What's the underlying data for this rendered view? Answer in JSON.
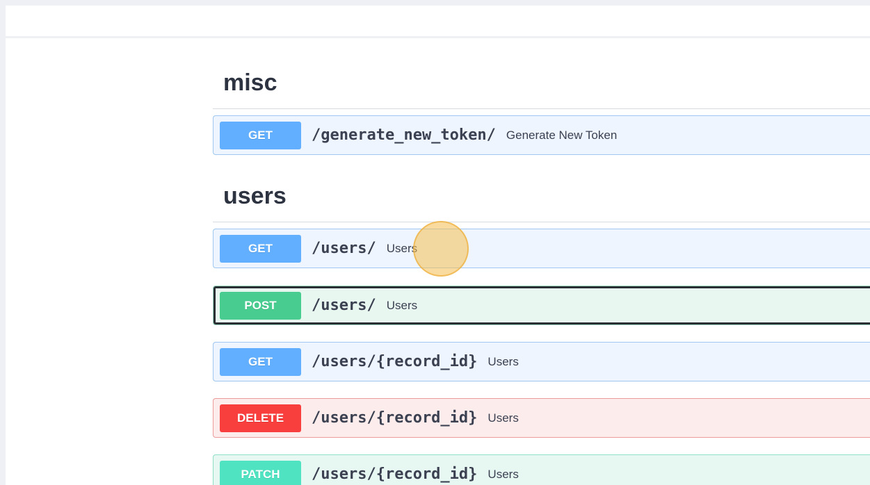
{
  "sections": [
    {
      "title": "misc",
      "operations": [
        {
          "method": "GET",
          "path": "/generate_new_token/",
          "summary": "Generate New Token"
        }
      ]
    },
    {
      "title": "users",
      "operations": [
        {
          "method": "GET",
          "path": "/users/",
          "summary": "Users"
        },
        {
          "method": "POST",
          "path": "/users/",
          "summary": "Users"
        },
        {
          "method": "GET",
          "path": "/users/{record_id}",
          "summary": "Users"
        },
        {
          "method": "DELETE",
          "path": "/users/{record_id}",
          "summary": "Users"
        },
        {
          "method": "PATCH",
          "path": "/users/{record_id}",
          "summary": "Users"
        }
      ]
    }
  ],
  "colors": {
    "get": "#61affe",
    "post": "#49cc90",
    "delete": "#f93e3e",
    "patch": "#50e3c2"
  }
}
